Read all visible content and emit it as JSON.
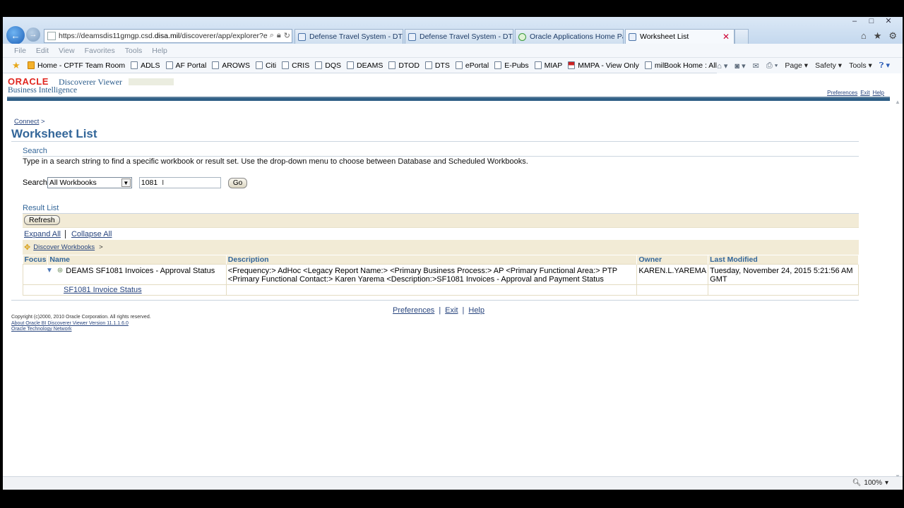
{
  "browser": {
    "address": {
      "prefix": "https://deamsdis11gmgp.csd.",
      "host": "disa.mil",
      "suffix": "/discoverer/app/explorer?eve"
    },
    "tabs": [
      {
        "label": "Defense Travel System - DTS"
      },
      {
        "label": "Defense Travel System - DTS"
      },
      {
        "label": "Oracle Applications Home Page"
      },
      {
        "label": "Worksheet List"
      }
    ],
    "menu": [
      "File",
      "Edit",
      "View",
      "Favorites",
      "Tools",
      "Help"
    ],
    "favorites": [
      "Home - CPTF Team Room",
      "ADLS",
      "AF Portal",
      "AROWS",
      "Citi",
      "CRIS",
      "DQS",
      "DEAMS",
      "DTOD",
      "DTS",
      "ePortal",
      "E-Pubs",
      "MIAP",
      "MMPA - View Only",
      "milBook Home : All Co..."
    ],
    "commands": {
      "page": "Page",
      "safety": "Safety",
      "tools": "Tools"
    },
    "zoom": "100%"
  },
  "app": {
    "oracle": "ORACLE",
    "product": "Discoverer Viewer",
    "subtitle": "Business Intelligence",
    "global_links": [
      "Preferences",
      "Exit",
      "Help"
    ]
  },
  "page": {
    "breadcrumb": "Connect",
    "title": "Worksheet List",
    "search": {
      "heading": "Search",
      "help": "Type in a search string to find a specific workbook or result set. Use the drop-down menu to choose between Database and Scheduled Workbooks.",
      "label": "Search",
      "scope": "All Workbooks",
      "query": "1081",
      "go_label": "Go"
    },
    "results": {
      "heading": "Result List",
      "refresh_label": "Refresh",
      "expand_all": "Expand All",
      "collapse_all": "Collapse All",
      "crumb": "Discover Workbooks",
      "columns": [
        "Focus",
        "Name",
        "Description",
        "Owner",
        "Last Modified"
      ],
      "workbook": {
        "name": "DEAMS SF1081 Invoices - Approval Status",
        "description": "<Frequency:> AdHoc <Legacy Report Name:> <Primary Business Process:> AP <Primary Functional Area:> PTP <Primary Functional Contact:> Karen Yarema <Description:>SF1081 Invoices - Approval and Payment Status",
        "owner": "KAREN.L.YAREMA",
        "modified": "Tuesday, November 24, 2015 5:21:56 AM GMT"
      },
      "worksheet": "SF1081 Invoice Status"
    },
    "footer_links": [
      "Preferences",
      "Exit",
      "Help"
    ],
    "copyright": [
      "Copyright (c)2000, 2010 Oracle Corporation. All rights reserved.",
      "About Oracle BI Discoverer Viewer Version 11.1.1.6.0",
      "Oracle Technology Network"
    ]
  }
}
